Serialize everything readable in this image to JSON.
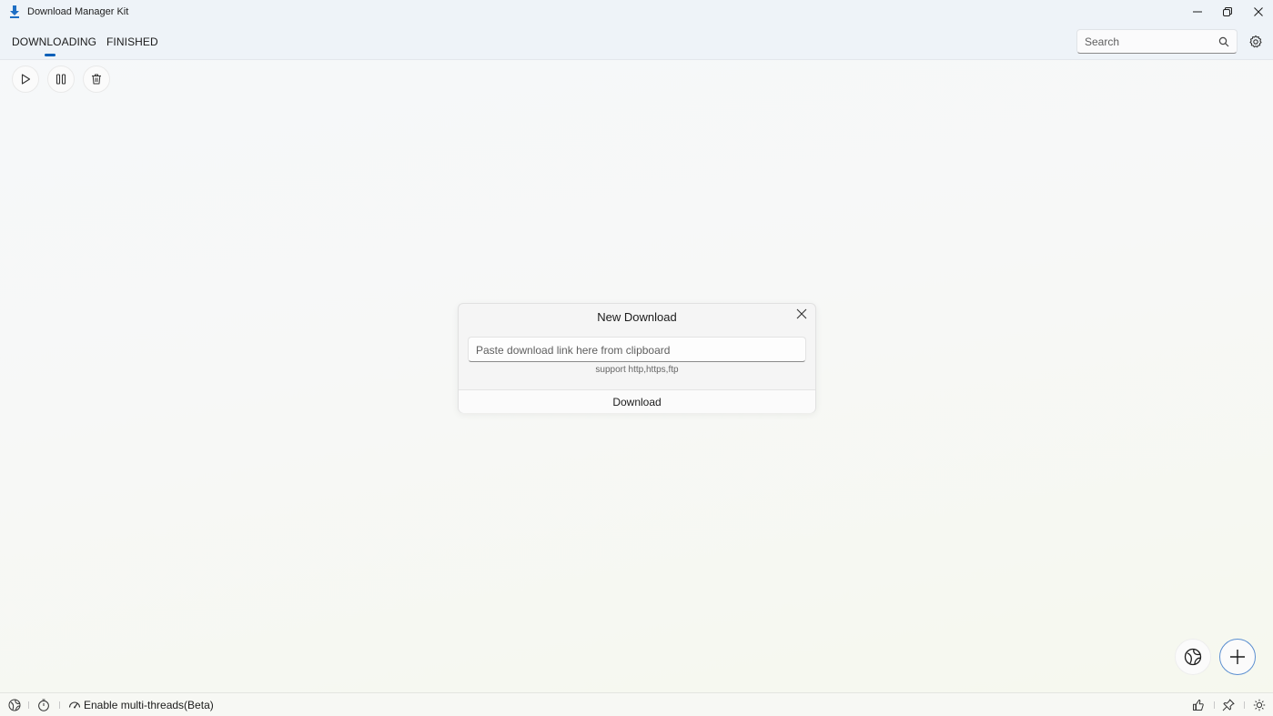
{
  "window": {
    "title": "Download Manager Kit",
    "accent_color": "#005fb8"
  },
  "tabs": [
    {
      "label": "DOWNLOADING",
      "selected": true
    },
    {
      "label": "FINISHED",
      "selected": false
    }
  ],
  "search": {
    "placeholder": "Search",
    "value": ""
  },
  "toolbar": {
    "icons": [
      "play-icon",
      "pause-icon",
      "delete-icon"
    ]
  },
  "dialog": {
    "title": "New Download",
    "link_placeholder": "Paste download link here from clipboard",
    "link_value": "",
    "support_note": "support http,https,ftp",
    "download_label": "Download"
  },
  "floating": {
    "icons": [
      "browser-icon",
      "add-icon"
    ]
  },
  "statusbar": {
    "multithread_label": "Enable multi-threads(Beta)",
    "left_icons": [
      "browser-icon",
      "timer-icon",
      "speed-icon"
    ],
    "right_icons": [
      "like-icon",
      "pin-icon",
      "theme-icon"
    ]
  }
}
